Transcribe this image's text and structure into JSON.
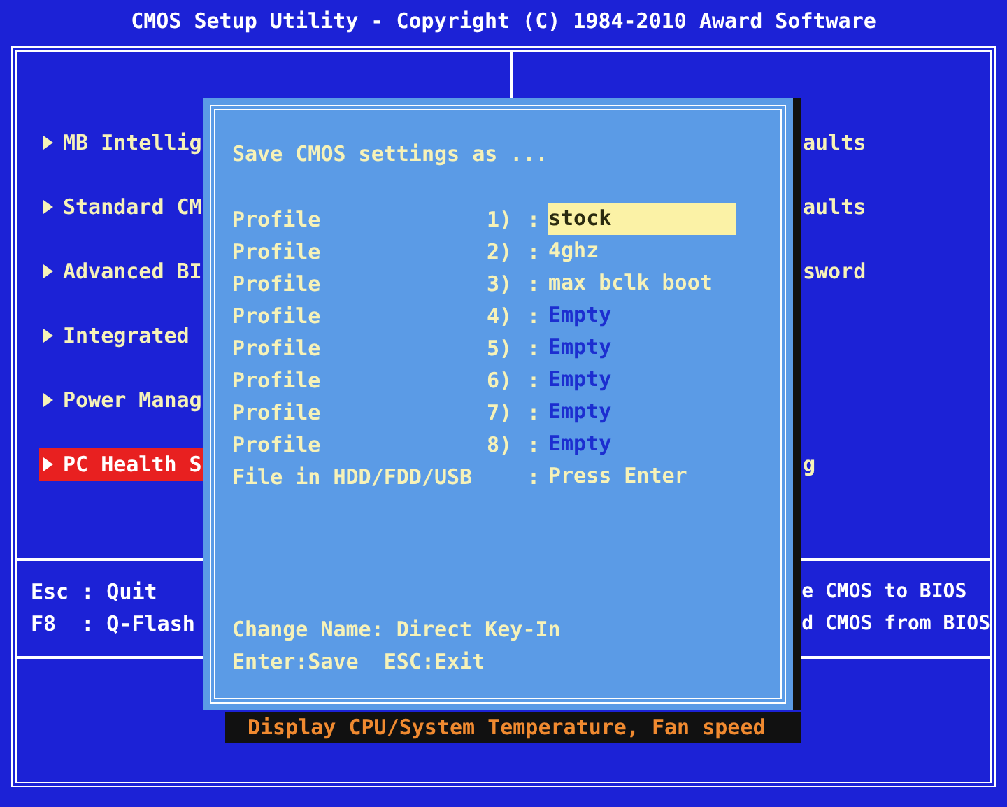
{
  "title": "CMOS Setup Utility - Copyright (C) 1984-2010 Award Software",
  "menu_rows": [
    {
      "left": {
        "label": "MB Intellig",
        "selected": false
      },
      "right": "aults"
    },
    {
      "left": {
        "label": "Standard CM",
        "selected": false
      },
      "right": "aults"
    },
    {
      "left": {
        "label": "Advanced BI",
        "selected": false
      },
      "right": "sword"
    },
    {
      "left": {
        "label": "Integrated",
        "selected": false
      }
    },
    {
      "left": {
        "label": "Power Manag",
        "selected": false
      }
    },
    {
      "left": {
        "label": "PC Health S",
        "selected": true
      },
      "right": "g"
    }
  ],
  "help_left": [
    "Esc : Quit",
    "F8  : Q-Flash"
  ],
  "help_right": [
    "e CMOS to BIOS",
    "d CMOS from BIOS"
  ],
  "dialog": {
    "title": "Save CMOS settings as ...",
    "rows": [
      {
        "kind": "profile",
        "label": "Profile",
        "number": "1)",
        "separator": ":",
        "value": "stock",
        "empty": false,
        "selected": true
      },
      {
        "kind": "profile",
        "label": "Profile",
        "number": "2)",
        "separator": ":",
        "value": "4ghz",
        "empty": false,
        "selected": false
      },
      {
        "kind": "profile",
        "label": "Profile",
        "number": "3)",
        "separator": ":",
        "value": "max bclk boot",
        "empty": false,
        "selected": false
      },
      {
        "kind": "profile",
        "label": "Profile",
        "number": "4)",
        "separator": ":",
        "value": "Empty",
        "empty": true,
        "selected": false
      },
      {
        "kind": "profile",
        "label": "Profile",
        "number": "5)",
        "separator": ":",
        "value": "Empty",
        "empty": true,
        "selected": false
      },
      {
        "kind": "profile",
        "label": "Profile",
        "number": "6)",
        "separator": ":",
        "value": "Empty",
        "empty": true,
        "selected": false
      },
      {
        "kind": "profile",
        "label": "Profile",
        "number": "7)",
        "separator": ":",
        "value": "Empty",
        "empty": true,
        "selected": false
      },
      {
        "kind": "profile",
        "label": "Profile",
        "number": "8)",
        "separator": ":",
        "value": "Empty",
        "empty": true,
        "selected": false
      },
      {
        "kind": "file",
        "label": "File in HDD/FDD/USB",
        "separator": ":",
        "value": "Press Enter",
        "selected": false
      }
    ],
    "hints": [
      "Change Name: Direct Key-In",
      "Enter:Save  ESC:Exit"
    ]
  },
  "status_bar": "Display CPU/System Temperature, Fan speed"
}
